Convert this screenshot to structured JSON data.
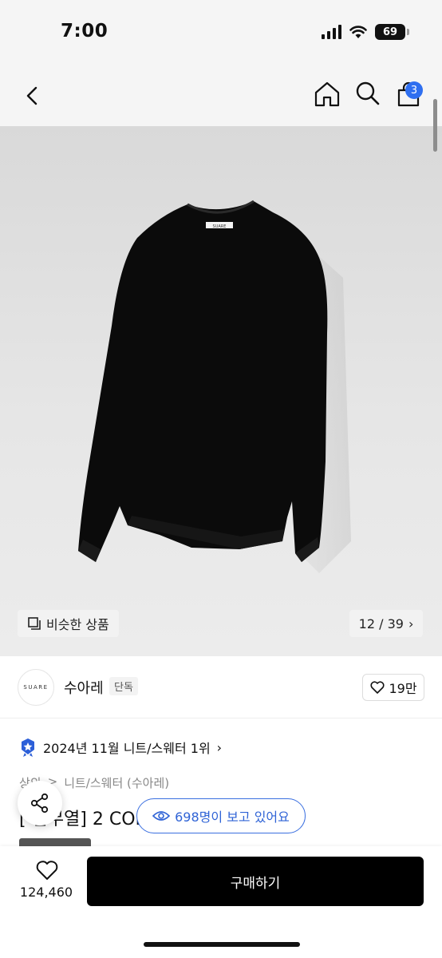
{
  "status_bar": {
    "time": "7:00",
    "battery": "69"
  },
  "nav": {
    "back_icon": "chevron-left-icon",
    "home_icon": "home-icon",
    "search_icon": "search-icon",
    "cart_icon": "bag-icon",
    "cart_badge": "3",
    "badge_color": "#2f6ff0"
  },
  "hero": {
    "similar_label": "비슷한 상품",
    "image_counter": "12 / 39",
    "counter_chevron": "›",
    "garment_label": "SUARE"
  },
  "brand": {
    "logo_text": "SUARE",
    "name": "수아레",
    "tag": "단독",
    "like_count": "19만"
  },
  "ranking": {
    "text": "2024년 11월 니트/스웨터 1위",
    "chevron": "›"
  },
  "category": {
    "level1": "상의",
    "separator": ">",
    "level2": "니트/스웨터 (수아레)"
  },
  "product": {
    "title": "[ 김무열]                               2 COLOR"
  },
  "viewers": {
    "text": "698명이 보고 있어요",
    "accent": "#2f63d6"
  },
  "bottom": {
    "wish_count": "124,460",
    "buy_label": "구매하기"
  }
}
